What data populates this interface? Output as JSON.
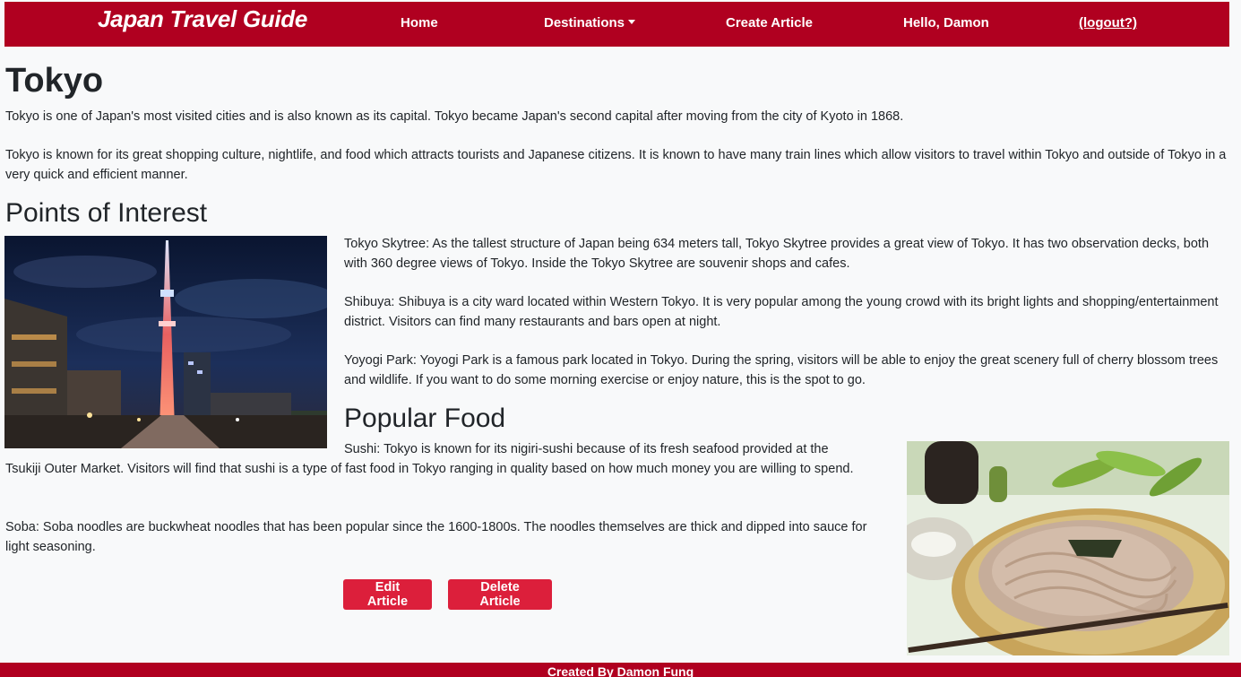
{
  "navbar": {
    "brand": "Japan Travel Guide",
    "home": "Home",
    "destinations": "Destinations",
    "create": "Create Article",
    "greeting": "Hello, Damon",
    "logout": "(logout?)"
  },
  "article": {
    "title": "Tokyo",
    "intro1": "Tokyo is one of Japan's most visited cities and is also known as its capital. Tokyo became Japan's second capital after moving from the city of Kyoto in 1868.",
    "intro2": "Tokyo is known for its great shopping culture, nightlife, and food which attracts tourists and Japanese citizens. It is known to have many train lines which allow visitors to travel within Tokyo and outside of Tokyo in a very quick and efficient manner.",
    "poi_heading": "Points of Interest",
    "poi": [
      "Tokyo Skytree: As the tallest structure of Japan being 634 meters tall, Tokyo Skytree provides a great view of Tokyo. It has two observation decks, both with 360 degree views of Tokyo. Inside the Tokyo Skytree are souvenir shops and cafes.",
      "Shibuya: Shibuya is a city ward located within Western Tokyo. It is very popular among the young crowd with its bright lights and shopping/entertainment district. Visitors can find many restaurants and bars open at night.",
      "Yoyogi Park: Yoyogi Park is a famous park located in Tokyo. During the spring, visitors will be able to enjoy the great scenery full of cherry blossom trees and wildlife. If you want to do some morning exercise or enjoy nature, this is the spot to go."
    ],
    "food_heading": "Popular Food",
    "sushi_line1": "Sushi: Tokyo is known for its nigiri-sushi because of its fresh seafood provided at the",
    "sushi_rest": "Tsukiji Outer Market. Visitors will find that sushi is a type of fast food in Tokyo ranging in quality based on how much money you are willing to spend.",
    "soba": "Soba: Soba noodles are buckwheat noodles that has been popular since the 1600-1800s. The noodles themselves are thick and dipped into sauce for light seasoning."
  },
  "actions": {
    "edit": "Edit Article",
    "delete": "Delete Article"
  },
  "footer": {
    "credit": "Created By Damon Fung"
  },
  "colors": {
    "brand": "#b00020",
    "button": "#dc1f3b",
    "background": "#f8f9fa"
  }
}
